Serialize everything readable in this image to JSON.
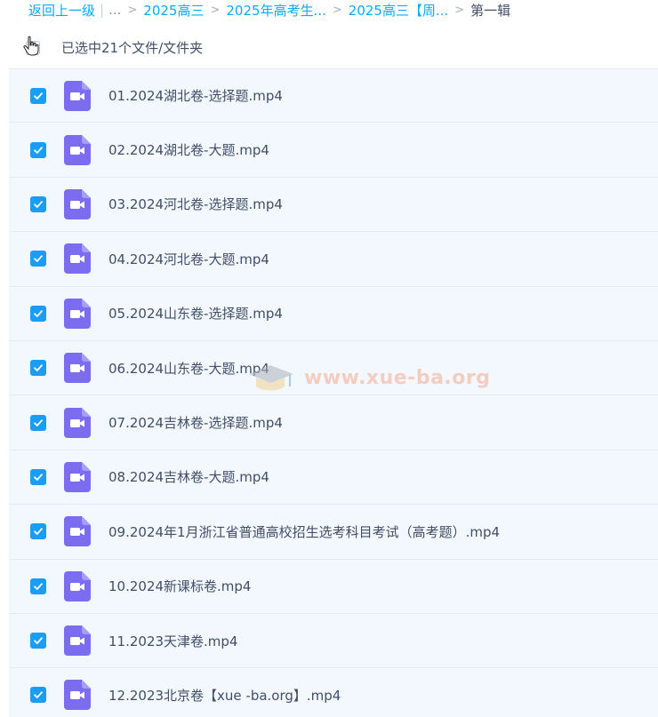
{
  "breadcrumb": {
    "back": "返回上一级",
    "ellipsis": "...",
    "crumbs": [
      "2025高三",
      "2025年高考生...",
      "2025高三【周..."
    ],
    "current": "第一辑"
  },
  "selection": {
    "label": "已选中21个文件/文件夹"
  },
  "files": [
    {
      "name": "01.2024湖北卷-选择题.mp4"
    },
    {
      "name": "02.2024湖北卷-大题.mp4"
    },
    {
      "name": "03.2024河北卷-选择题.mp4"
    },
    {
      "name": "04.2024河北卷-大题.mp4"
    },
    {
      "name": "05.2024山东卷-选择题.mp4"
    },
    {
      "name": "06.2024山东卷-大题.mp4"
    },
    {
      "name": "07.2024吉林卷-选择题.mp4"
    },
    {
      "name": "08.2024吉林卷-大题.mp4"
    },
    {
      "name": "09.2024年1月浙江省普通高校招生选考科目考试（高考题）.mp4"
    },
    {
      "name": "10.2024新课标卷.mp4"
    },
    {
      "name": "11.2023天津卷.mp4"
    },
    {
      "name": "12.2023北京卷【xue -ba.org】.mp4"
    }
  ],
  "watermark": "www.xue-ba.org",
  "colors": {
    "link": "#09aaff",
    "checkbox": "#1a9df5",
    "video_icon": "#7b6cf0",
    "row_bg": "#f3f8fe"
  },
  "icons": {
    "file": "video-file-icon",
    "check": "checkmark-icon"
  }
}
